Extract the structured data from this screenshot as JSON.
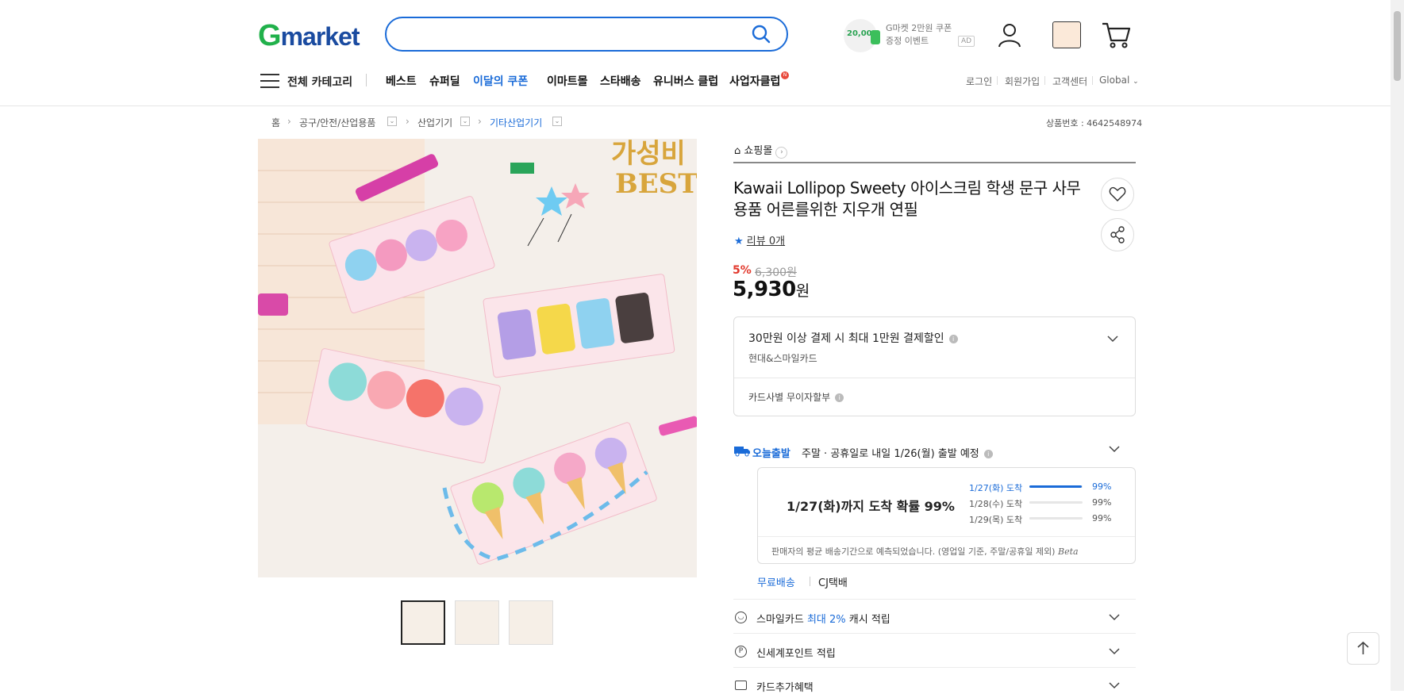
{
  "header": {
    "logo_g": "G",
    "logo_rest": "market",
    "search_placeholder": "",
    "promo_amount": "20,000",
    "promo_line1": "G마켓 2만원 쿠폰",
    "promo_line2": "증정 이벤트",
    "ad_label": "AD"
  },
  "nav": {
    "all_category": "전체 카테고리",
    "items": [
      "베스트",
      "슈퍼딜",
      "이달의 쿠폰",
      "이마트몰",
      "스타배송",
      "유니버스 클럽",
      "사업자클럽"
    ],
    "new_badge": "N",
    "util": [
      "로그인",
      "회원가입",
      "고객센터",
      "Global"
    ]
  },
  "breadcrumb": {
    "items": [
      "홈",
      "공구/안전/산업용품",
      "산업기기",
      "기타산업기기"
    ],
    "product_number": "상품번호 : 4642548974"
  },
  "product": {
    "shop_label": "쇼핑몰",
    "title": "Kawaii Lollipop Sweety 아이스크림 학생 문구 사무용품 어른를위한 지우개 연필",
    "review_label": "리뷰 0개",
    "discount": "5%",
    "original_price": "6,300원",
    "price": "5,930",
    "price_unit": "원",
    "image_text_1": "가성비",
    "image_text_2": "BEST"
  },
  "card_benefit": {
    "title": "30만원 이상 결제 시 최대 1만원 결제할인",
    "cards": "현대&스마일카드",
    "installment": "카드사별 무이자할부"
  },
  "shipping": {
    "label": "오늘출발",
    "text": "주말 · 공휴일로 내일 1/26(월) 출발 예정",
    "probability": "1/27(화)까지 도착 확률 99%",
    "rows": [
      {
        "date": "1/27(화) 도착",
        "pct": "99%",
        "value": 99
      },
      {
        "date": "1/28(수) 도착",
        "pct": "99%",
        "value": 99
      },
      {
        "date": "1/29(목) 도착",
        "pct": "99%",
        "value": 99
      }
    ],
    "note": "판매자의 평균 배송기간으로 예측되었습니다. (영업일 기준, 주말/공휴일 제외)",
    "beta": "Beta",
    "free": "무료배송",
    "courier": "CJ택배"
  },
  "benefits": {
    "smile_prefix": "스마일카드",
    "smile_highlight": "최대 2%",
    "smile_suffix": "캐시 적립",
    "point": "신세계포인트 적립",
    "card_extra": "카드추가혜택"
  },
  "colors": {
    "accent": "#1a6bd8",
    "logo_green": "#21b14b",
    "logo_blue": "#1a4ba0",
    "discount_red": "#e23a2e"
  }
}
